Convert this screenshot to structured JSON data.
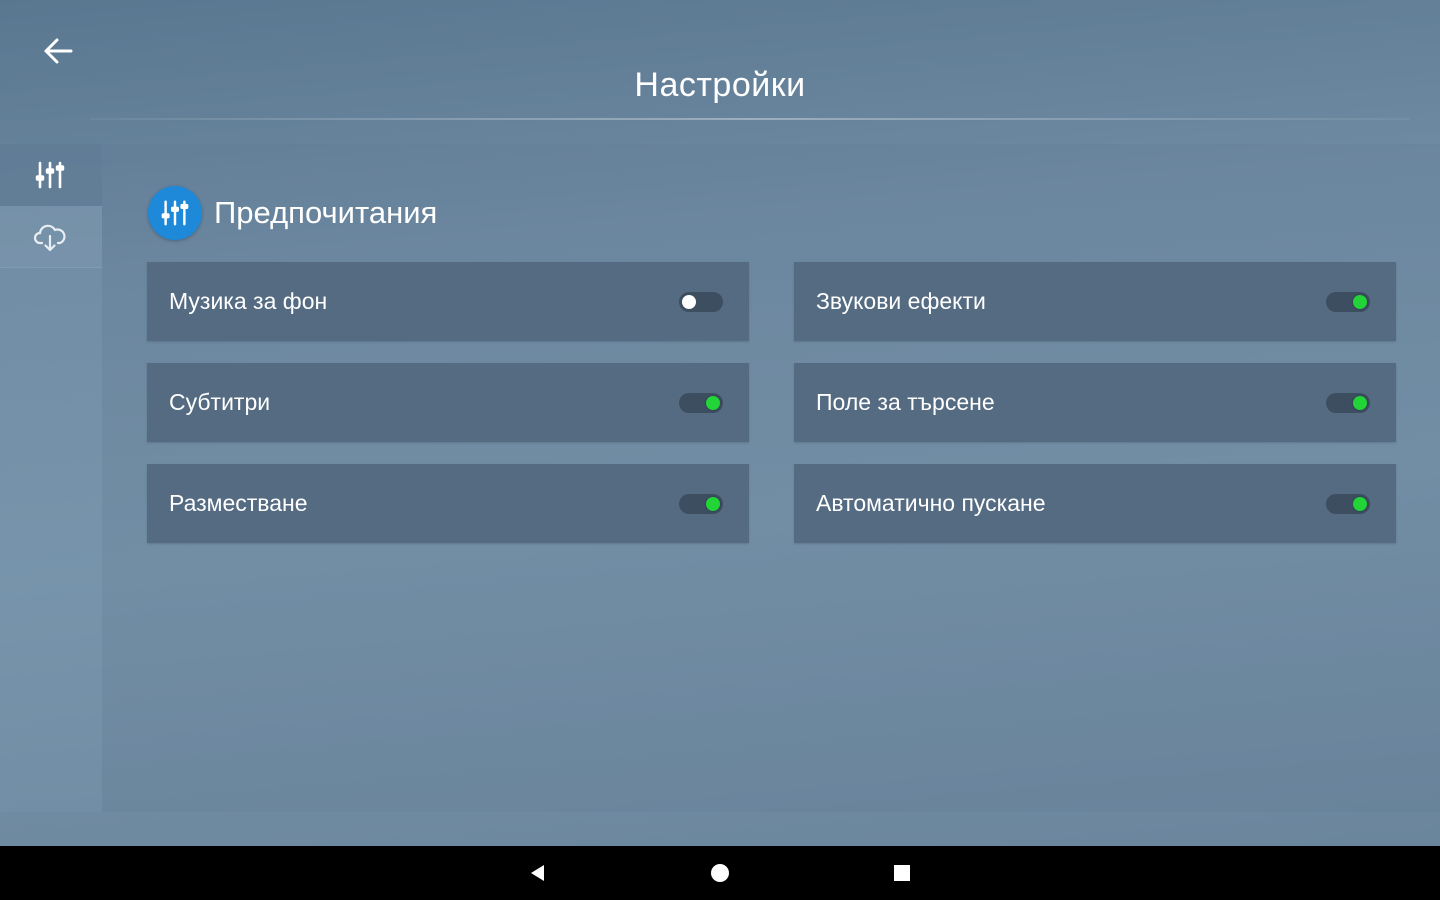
{
  "header": {
    "title": "Настройки",
    "back_icon": "arrow-left-icon"
  },
  "sidebar": {
    "tabs": [
      {
        "icon": "sliders-icon",
        "active": true
      },
      {
        "icon": "cloud-download-icon",
        "active": false
      }
    ]
  },
  "section": {
    "title": "Предпочитания",
    "icon": "sliders-icon",
    "icon_color": "#1e88d9"
  },
  "settings": [
    {
      "label": "Музика за фон",
      "enabled": false
    },
    {
      "label": "Звукови ефекти",
      "enabled": true
    },
    {
      "label": "Субтитри",
      "enabled": true
    },
    {
      "label": "Поле за търсене",
      "enabled": true
    },
    {
      "label": "Разместване",
      "enabled": true
    },
    {
      "label": "Автоматично пускане",
      "enabled": true
    }
  ],
  "colors": {
    "toggle_on": "#22d438",
    "toggle_off": "#ffffff",
    "card_bg": "#546b82"
  },
  "navbar": {
    "buttons": [
      "back-triangle-icon",
      "home-circle-icon",
      "recents-square-icon"
    ]
  }
}
